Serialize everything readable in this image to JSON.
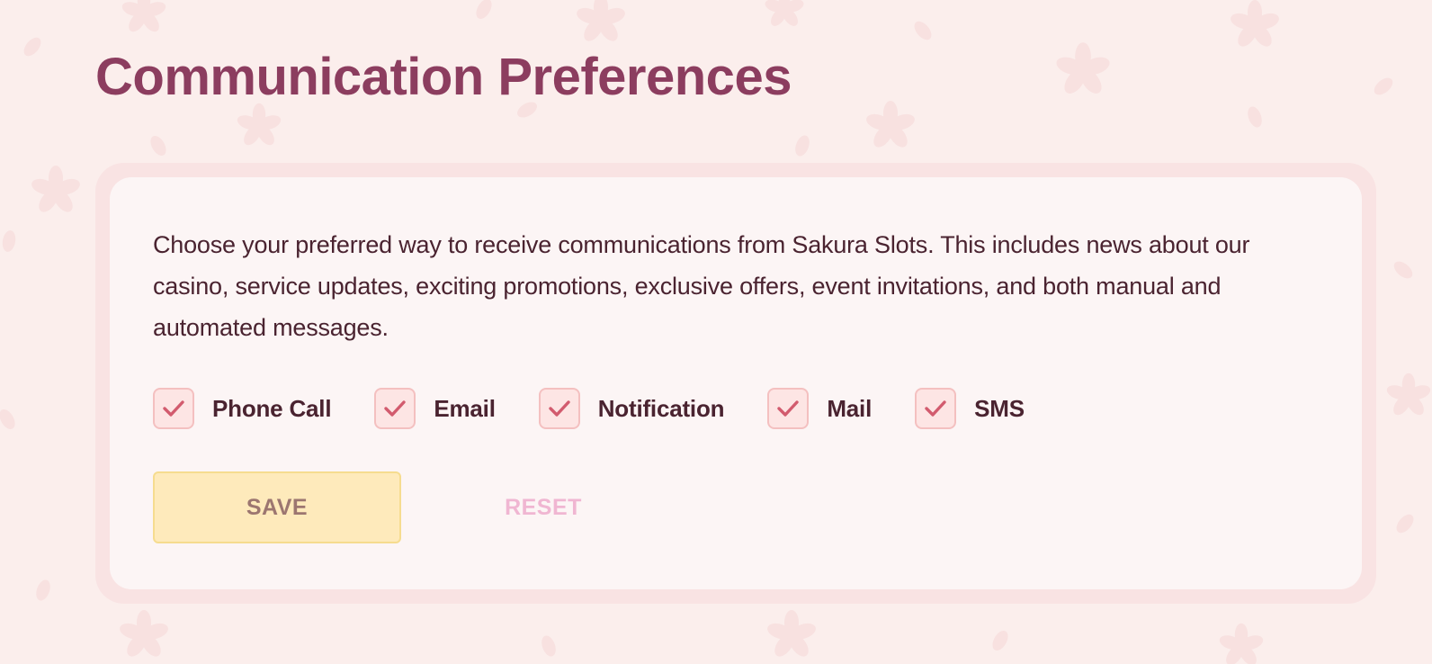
{
  "page": {
    "title": "Communication Preferences"
  },
  "card": {
    "description": "Choose your preferred way to receive communications from Sakura Slots. This includes news about our casino, service updates, exciting promotions, exclusive offers, event invitations, and both manual and automated messages."
  },
  "options": [
    {
      "label": "Phone Call",
      "checked": true
    },
    {
      "label": "Email",
      "checked": true
    },
    {
      "label": "Notification",
      "checked": true
    },
    {
      "label": "Mail",
      "checked": true
    },
    {
      "label": "SMS",
      "checked": true
    }
  ],
  "actions": {
    "save_label": "SAVE",
    "reset_label": "RESET"
  },
  "theme": {
    "background": "#fbeeec",
    "title_color": "#8c3d5f",
    "check_color": "#d25b6e",
    "save_bg": "#feeabb",
    "reset_color": "#f0b6d2"
  },
  "icons": {
    "checkbox": "checkmark-icon",
    "background": "sakura-petal-icon"
  }
}
